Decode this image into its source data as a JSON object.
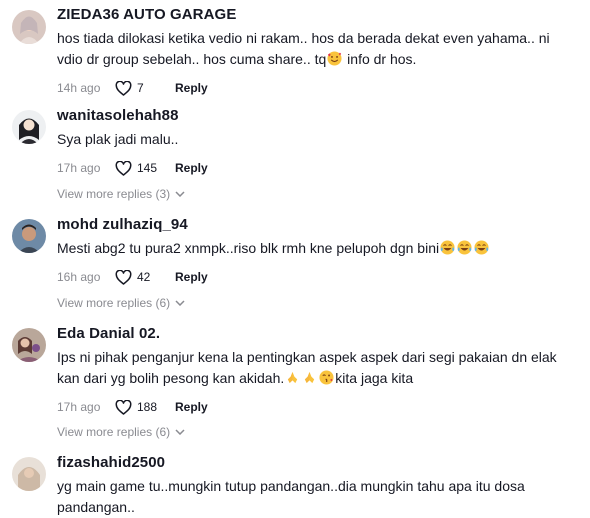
{
  "comments": [
    {
      "username": "ZIEDA36 AUTO GARAGE",
      "text_before": "hos tiada dilokasi ketika vedio ni rakam.. hos da berada dekat even yahama.. ni vdio dr group sebelah.. hos cuma share.. tq",
      "emoji1": "smiling-face-hearts-emoji",
      "text_after": " info dr hos.",
      "time": "14h ago",
      "likes": "7",
      "reply": "Reply"
    },
    {
      "username": "wanitasolehah88",
      "text": "Sya plak jadi malu..",
      "time": "17h ago",
      "likes": "145",
      "reply": "Reply",
      "view_more": "View more replies (3)"
    },
    {
      "username": "mohd zulhaziq_94",
      "text": "Mesti abg2 tu pura2 xnmpk..riso blk rmh kne pelupoh dgn bini",
      "emoji": "tears-of-joy-emoji",
      "time": "16h ago",
      "likes": "42",
      "reply": "Reply",
      "view_more": "View more replies (6)"
    },
    {
      "username": "Eda Danial 02.",
      "text_before": "Ips ni pihak penganjur kena la pentingkan aspek aspek dari segi pakaian dn elak kan dari yg bolih pesong kan akidah.",
      "emoji_pray": "folded-hands-emoji",
      "emoji_kiss": "face-blowing-kiss-emoji",
      "text_after": "kita jaga kita",
      "time": "17h ago",
      "likes": "188",
      "reply": "Reply",
      "view_more": "View more replies (6)"
    },
    {
      "username": "fizashahid2500",
      "text": "yg main game tu..mungkin tutup pandangan..dia mungkin tahu apa itu dosa pandangan..",
      "time": "",
      "likes": "",
      "reply": ""
    }
  ],
  "colors": {
    "text": "#161823",
    "muted": "#8a8b91",
    "background": "#ffffff"
  }
}
